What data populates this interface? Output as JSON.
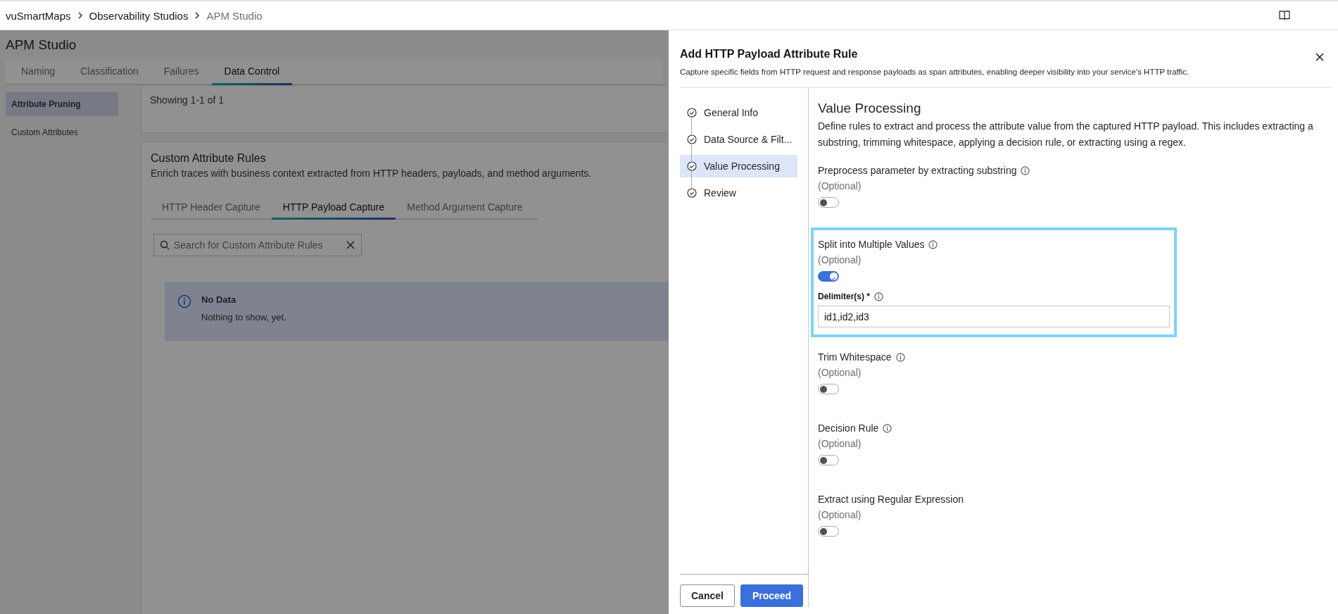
{
  "topbar": {
    "breadcrumbs": [
      {
        "label": "vuSmartMaps"
      },
      {
        "label": "Observability Studios"
      },
      {
        "label": "APM Studio"
      }
    ]
  },
  "background_page": {
    "title": "APM Studio",
    "tabs": [
      {
        "label": "Naming",
        "selected": false
      },
      {
        "label": "Classification",
        "selected": false
      },
      {
        "label": "Failures",
        "selected": false
      },
      {
        "label": "Data Control",
        "selected": true
      }
    ],
    "sidebar": {
      "items": [
        {
          "label": "Attribute Pruning",
          "selected": true
        },
        {
          "label": "Custom Attributes",
          "selected": false
        }
      ]
    },
    "summary": "Showing 1-1 of 1",
    "rules_card": {
      "title": "Custom Attribute Rules",
      "description": "Enrich traces with business context extracted from HTTP headers, payloads, and method arguments.",
      "tabs": [
        {
          "label": "HTTP Header Capture",
          "selected": false
        },
        {
          "label": "HTTP Payload Capture",
          "selected": true
        },
        {
          "label": "Method Argument Capture",
          "selected": false
        }
      ],
      "search": {
        "placeholder": "Search for Custom Attribute Rules"
      },
      "notice": {
        "title": "No Data",
        "message": "Nothing to show, yet."
      }
    }
  },
  "drawer": {
    "title": "Add HTTP Payload Attribute Rule",
    "description": "Capture specific fields from HTTP request and response payloads as span attributes, enabling deeper visibility into your service's HTTP traffic.",
    "steps": [
      {
        "label": "General Info",
        "selected": false
      },
      {
        "label": "Data Source & Filt...",
        "selected": false
      },
      {
        "label": "Value Processing",
        "selected": true
      },
      {
        "label": "Review",
        "selected": false
      }
    ],
    "section_title": "Value Processing",
    "section_description": "Define rules to extract and process the attribute value from the captured HTTP payload. This includes extracting a substring, trimming whitespace, applying a decision rule, or extracting using a regex.",
    "options": [
      {
        "label": "Preprocess parameter by extracting substring",
        "info": true,
        "optional": "(Optional)",
        "on": false,
        "highlighted": false
      },
      {
        "label": "Split into Multiple Values",
        "info": true,
        "optional": "(Optional)",
        "on": true,
        "highlighted": true,
        "field": {
          "label": "Delimiter(s) *",
          "info": true,
          "value": "id1,id2,id3"
        }
      },
      {
        "label": "Trim Whitespace",
        "info": true,
        "optional": "(Optional)",
        "on": false,
        "highlighted": false
      },
      {
        "label": "Decision Rule",
        "info": true,
        "optional": "(Optional)",
        "on": false,
        "highlighted": false
      },
      {
        "label": "Extract using Regular Expression",
        "info": false,
        "optional": "(Optional)",
        "on": false,
        "highlighted": false
      }
    ],
    "buttons": [
      {
        "label": "Cancel",
        "kind": "secondary"
      },
      {
        "label": "Proceed",
        "kind": "primary"
      }
    ]
  }
}
